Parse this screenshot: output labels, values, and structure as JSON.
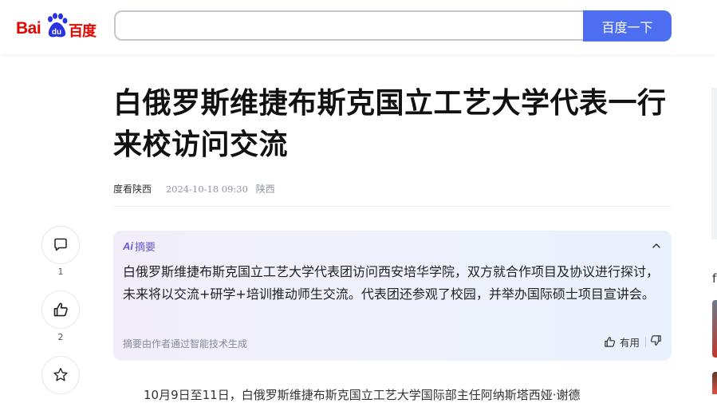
{
  "header": {
    "logo_text": "Bai",
    "logo_text_cn": "百度",
    "logo_paw_text": "du",
    "search_value": "",
    "search_button": "百度一下",
    "brand_color": "#e10601",
    "accent_color": "#4e6ef2"
  },
  "article": {
    "title": "白俄罗斯维捷布斯克国立工艺大学代表一行来校访问交流",
    "source": "度看陕西",
    "time": "2024-10-18 09:30",
    "location": "陕西",
    "first_line": "10月9日至11日，白俄罗斯维捷布斯克国立工艺大学国际部主任阿纳斯塔西娅·谢德"
  },
  "summary": {
    "label": "摘要",
    "ai_badge": "Ai",
    "text": "白俄罗斯维捷布斯克国立工艺大学代表团访问西安培华学院，双方就合作项目及协议进行探讨，未来将以交流+研学+培训推动师生交流。代表团还参观了校园，并举办国际硕士项目宣讲会。",
    "footnote": "摘要由作者通过智能技术生成",
    "useful_label": "有用",
    "label_color": "#6b58d8"
  },
  "actions": {
    "comment_count": "1",
    "like_count": "2",
    "icons": [
      "comment-icon",
      "thumbs-up-icon",
      "star-icon"
    ]
  },
  "right_rail": {
    "partial_char": "f"
  }
}
